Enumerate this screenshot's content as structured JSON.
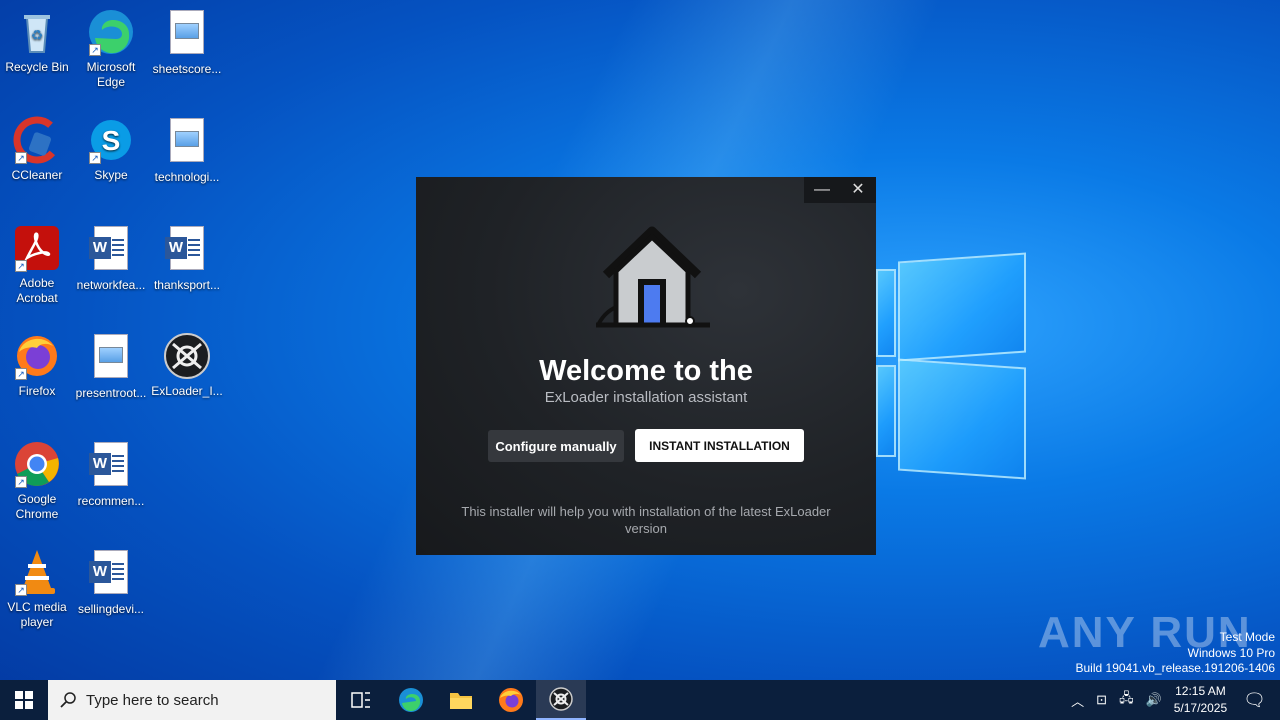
{
  "desktop": {
    "icons": [
      {
        "label": "Recycle Bin",
        "icon": "recycle-bin-icon"
      },
      {
        "label": "Microsoft Edge",
        "icon": "edge-icon"
      },
      {
        "label": "sheetscore...",
        "icon": "image-file-icon"
      },
      {
        "label": "CCleaner",
        "icon": "ccleaner-icon"
      },
      {
        "label": "Skype",
        "icon": "skype-icon"
      },
      {
        "label": "technologi...",
        "icon": "image-file-icon"
      },
      {
        "label": "Adobe Acrobat",
        "icon": "acrobat-icon"
      },
      {
        "label": "networkfea...",
        "icon": "word-file-icon"
      },
      {
        "label": "thanksport...",
        "icon": "word-file-icon"
      },
      {
        "label": "Firefox",
        "icon": "firefox-icon"
      },
      {
        "label": "presentroot...",
        "icon": "image-file-icon"
      },
      {
        "label": "ExLoader_I...",
        "icon": "exloader-icon"
      },
      {
        "label": "Google Chrome",
        "icon": "chrome-icon"
      },
      {
        "label": "recommen...",
        "icon": "word-file-icon"
      },
      {
        "label": "VLC media player",
        "icon": "vlc-icon"
      },
      {
        "label": "sellingdevi...",
        "icon": "word-file-icon"
      }
    ]
  },
  "dialog": {
    "title": "Welcome to the",
    "subtitle": "ExLoader installation assistant",
    "configure_label": "Configure manually",
    "instant_label": "INSTANT INSTALLATION",
    "note": "This installer will help you with installation of the latest ExLoader version",
    "minimize": "—",
    "close": "✕"
  },
  "watermark": {
    "brand": "ANY RUN",
    "line1": "Test Mode",
    "line2": "Windows 10 Pro",
    "line3": "Build 19041.vb_release.191206-1406"
  },
  "taskbar": {
    "search_placeholder": "Type here to search",
    "time": "12:15 AM",
    "date": "5/17/2025"
  },
  "colors": {
    "accent": "#0a7ae6",
    "taskbar": "#0b1f3d",
    "dialog_bg": "#1f2226"
  }
}
